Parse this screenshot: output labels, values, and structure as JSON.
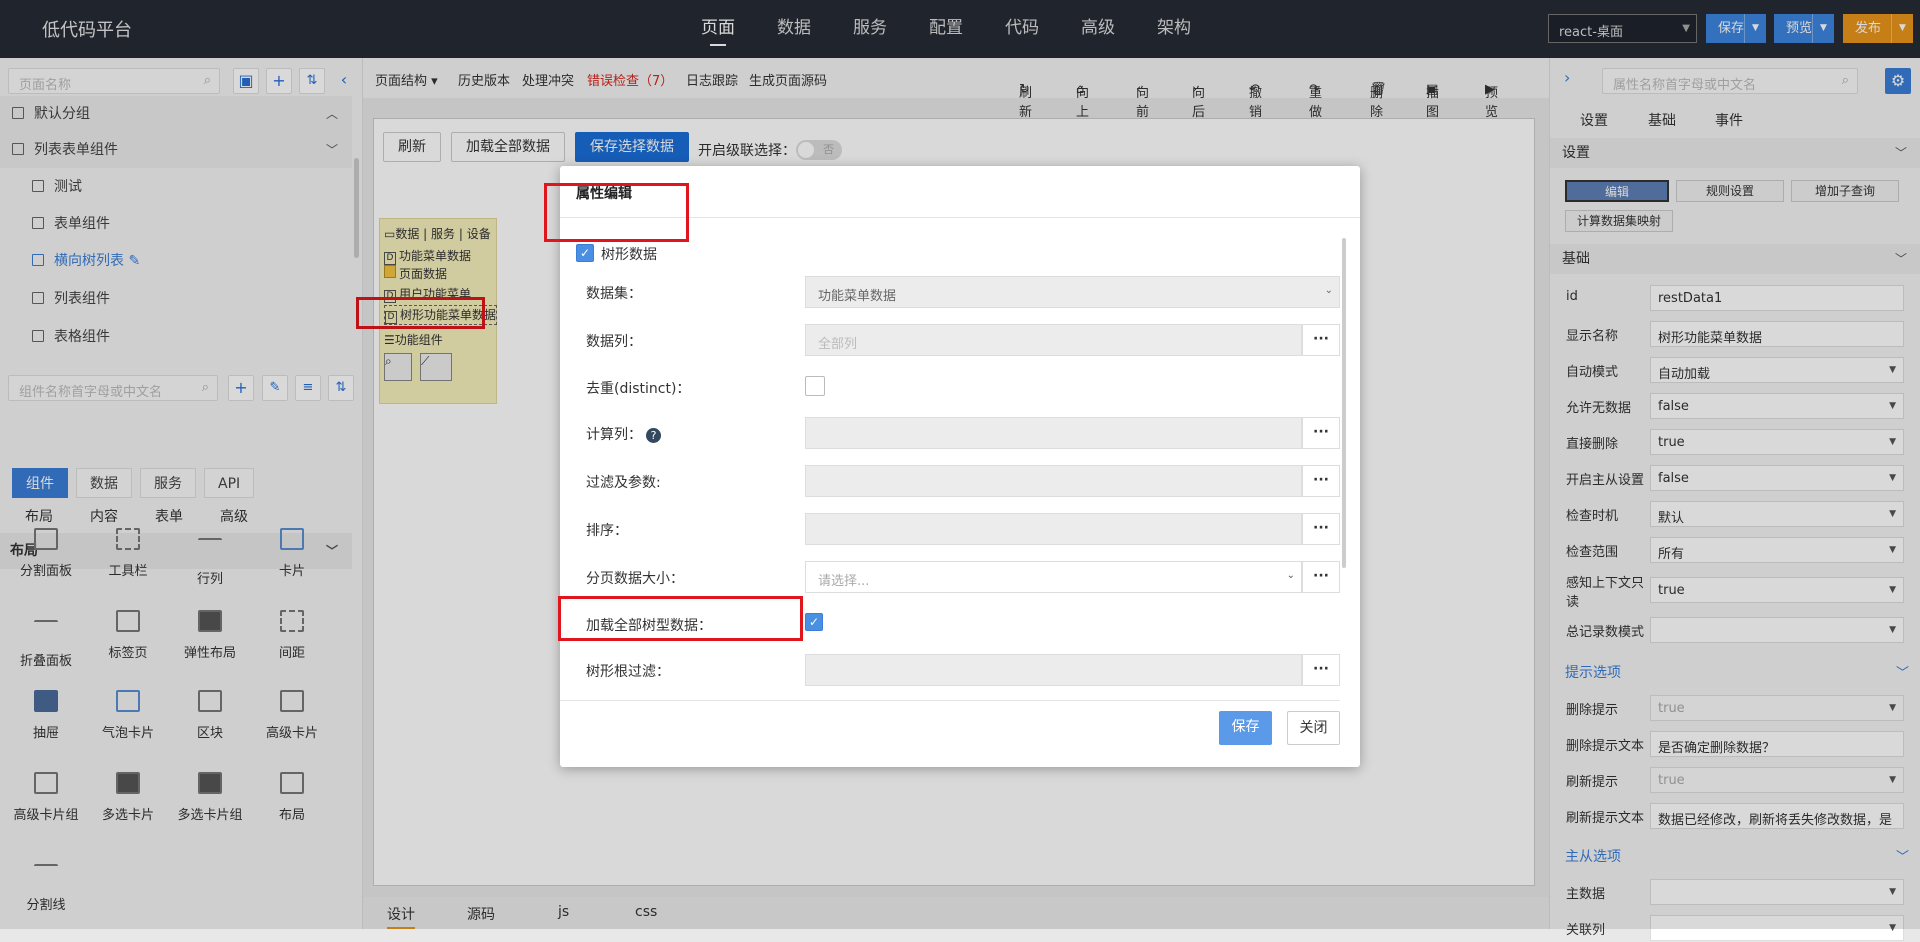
{
  "header": {
    "app_title": "低代码平台",
    "nav": [
      "页面",
      "数据",
      "服务",
      "配置",
      "代码",
      "高级",
      "架构"
    ],
    "app_select": "react-桌面",
    "save": "保存",
    "preview": "预览",
    "publish": "发布",
    "colors": {
      "bar": "#262c36",
      "save": "#3d85e0",
      "preview": "#3d85e0",
      "publish": "#e8961a"
    }
  },
  "left": {
    "page_search_placeholder": "页面名称",
    "tree": [
      {
        "label": "默认分组",
        "type": "group"
      },
      {
        "label": "列表表单组件",
        "type": "group"
      },
      {
        "label": "测试",
        "type": "page"
      },
      {
        "label": "表单组件",
        "type": "page"
      },
      {
        "label": "横向树列表",
        "type": "page",
        "active": true
      },
      {
        "label": "列表组件",
        "type": "page"
      },
      {
        "label": "表格组件",
        "type": "page"
      }
    ],
    "comp_search_placeholder": "组件名称首字母或中文名",
    "tabs": [
      "组件",
      "数据",
      "服务",
      "API"
    ],
    "subtabs": [
      "布局",
      "内容",
      "表单",
      "高级"
    ],
    "section_title": "布局",
    "components": [
      "分割面板",
      "工具栏",
      "行列",
      "卡片",
      "折叠面板",
      "标签页",
      "弹性布局",
      "间距",
      "抽屉",
      "气泡卡片",
      "区块",
      "高级卡片",
      "高级卡片组",
      "多选卡片",
      "多选卡片组",
      "布局",
      "分割线"
    ]
  },
  "toolbar": {
    "items": [
      "页面结构 ▾",
      "历史版本",
      "处理冲突",
      "错误检查（7）",
      "日志跟踪",
      "生成页面源码"
    ],
    "actions": [
      "刷新",
      "向上",
      "向前",
      "向后",
      "撤销",
      "重做",
      "删除",
      "插图",
      "预览"
    ]
  },
  "canvas": {
    "buttons": [
      "刷新",
      "加载全部数据",
      "保存选择数据"
    ],
    "cascade_label": "开启级联选择：",
    "switch_text": "否",
    "tree_header": "数据 | 服务 | 设备",
    "tree_items": [
      "功能菜单数据",
      "页面数据",
      "用户功能菜单",
      "树形功能菜单数据"
    ],
    "func_label": "功能组件",
    "bottom_tabs": [
      "设计",
      "源码",
      "js",
      "css"
    ]
  },
  "modal": {
    "title": "属性编辑",
    "tree_data_label": "树形数据",
    "fields": [
      {
        "label": "数据集：",
        "value": "功能菜单数据"
      },
      {
        "label": "数据列：",
        "value": "全部列"
      },
      {
        "label": "去重(distinct)：",
        "value": ""
      },
      {
        "label": "计算列：",
        "value": ""
      },
      {
        "label": "过滤及参数:",
        "value": ""
      },
      {
        "label": "排序：",
        "value": ""
      },
      {
        "label": "分页数据大小：",
        "value": "请选择..."
      },
      {
        "label": "加载全部树型数据：",
        "value": ""
      },
      {
        "label": "树形根过滤：",
        "value": ""
      }
    ],
    "save": "保存",
    "close": "关闭"
  },
  "right": {
    "search_placeholder": "属性名称首字母或中文名",
    "tabs": [
      "设置",
      "基础",
      "事件"
    ],
    "settings_title": "设置",
    "setting_buttons": [
      "编辑",
      "规则设置",
      "增加子查询",
      "计算数据集映射"
    ],
    "basic_title": "基础",
    "props": [
      {
        "k": "id",
        "v": "restData1"
      },
      {
        "k": "显示名称",
        "v": "树形功能菜单数据"
      },
      {
        "k": "自动模式",
        "v": "自动加载"
      },
      {
        "k": "允许无数据",
        "v": "false"
      },
      {
        "k": "直接删除",
        "v": "true"
      },
      {
        "k": "开启主从设置",
        "v": "false"
      },
      {
        "k": "检查时机",
        "v": "默认"
      },
      {
        "k": "检查范围",
        "v": "所有"
      },
      {
        "k": "感知上下文只读",
        "v": "true"
      },
      {
        "k": "总记录数模式",
        "v": ""
      }
    ],
    "hint_title": "提示选项",
    "hint_props": [
      {
        "k": "删除提示",
        "v": "true"
      },
      {
        "k": "删除提示文本",
        "v": "是否确定删除数据？"
      },
      {
        "k": "刷新提示",
        "v": "true"
      },
      {
        "k": "刷新提示文本",
        "v": "数据已经修改，刷新将丢失修改数据，是"
      }
    ],
    "master_title": "主从选项",
    "master_props": [
      {
        "k": "主数据",
        "v": ""
      },
      {
        "k": "关联列",
        "v": ""
      }
    ]
  }
}
